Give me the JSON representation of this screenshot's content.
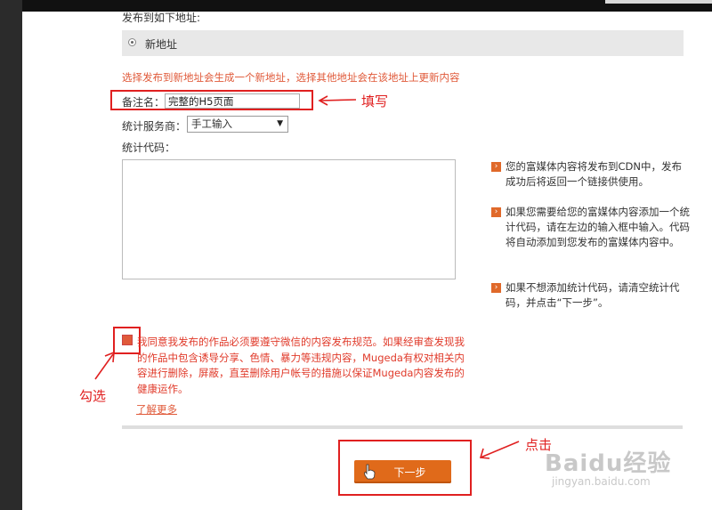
{
  "section_title": "发布到如下地址:",
  "address_option": "新地址",
  "notice": "选择发布到新地址会生成一个新地址，选择其他地址会在该地址上更新内容",
  "remark": {
    "label": "备注名：",
    "value": "完整的H5页面"
  },
  "stats_provider": {
    "label": "统计服务商：",
    "selected": "手工输入"
  },
  "stats_code": {
    "label": "统计代码：",
    "value": ""
  },
  "tips": [
    "您的富媒体内容将发布到CDN中，发布成功后将返回一个链接供使用。",
    "如果您需要给您的富媒体内容添加一个统计代码，请在左边的输入框中输入。代码将自动添加到您发布的富媒体内容中。",
    "如果不想添加统计代码，请清空统计代码，并点击“下一步”。"
  ],
  "agreement": "我同意我发布的作品必须要遵守微信的内容发布规范。如果经审查发现我的作品中包含诱导分享、色情、暴力等违规内容，Mugeda有权对相关内容进行删除，屏蔽，直至删除用户帐号的措施以保证Mugeda内容发布的健康运作。",
  "learn_more": "了解更多",
  "next_button": "下一步",
  "annotations": {
    "fill": "填写",
    "check": "勾选",
    "click": "点击"
  },
  "watermark": {
    "brand": "Baidu经验",
    "url": "jingyan.baidu.com"
  },
  "colors": {
    "accent": "#e06a1a",
    "highlight": "#e02020",
    "notice": "#e05a3a"
  }
}
